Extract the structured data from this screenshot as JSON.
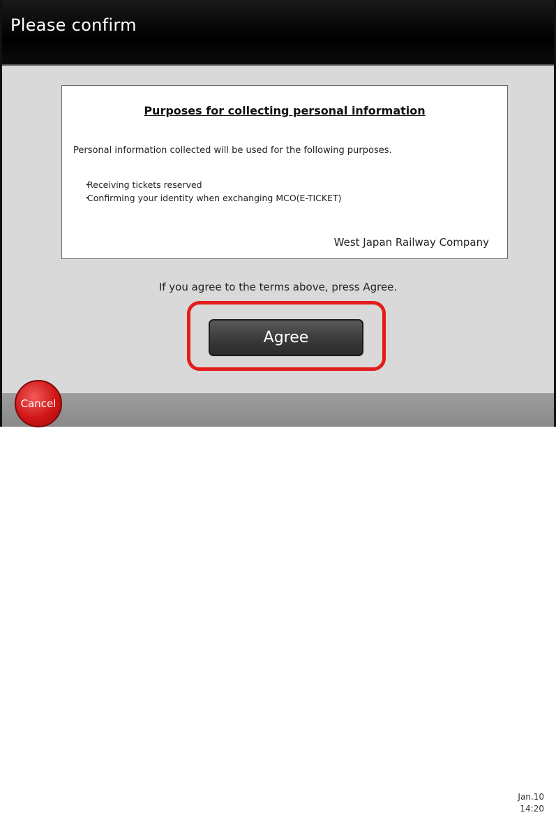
{
  "header": {
    "title": "Please confirm"
  },
  "notice": {
    "title": "Purposes for collecting personal information",
    "intro": "Personal information collected will be used for the following purposes.",
    "items": [
      "Receiving tickets reserved",
      "Confirming your identity when exchanging MCO(E-TICKET)"
    ],
    "bullet": "・",
    "company": "West Japan Railway Company"
  },
  "instruction": "If you agree to the terms above, press Agree.",
  "agree_button": {
    "label": "Agree"
  },
  "cancel_button": {
    "label": "Cancel"
  },
  "footer": {
    "date": "Jan.10",
    "time": "14:20"
  },
  "colors": {
    "highlight": "#e31c1c",
    "cancel": "#d01616",
    "header": "#000000"
  }
}
